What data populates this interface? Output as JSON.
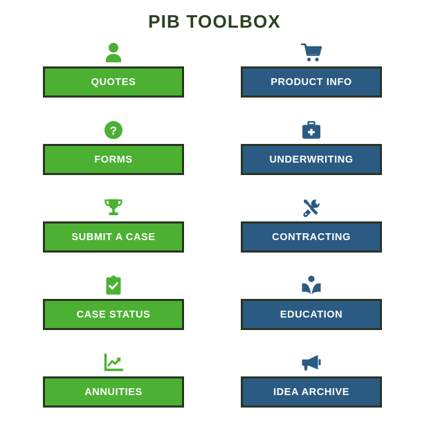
{
  "header": {
    "title": "PIB TOOLBOX",
    "title_color": "#2c4020"
  },
  "theme": {
    "green": "#4cb033",
    "blue": "#2b5b83",
    "border": "#2a3524",
    "label_color": "#ffffff",
    "background": "#ffffff"
  },
  "tiles": [
    {
      "label": "QUOTES",
      "color": "green",
      "icon": "user-icon",
      "icon_color": "#4cb033"
    },
    {
      "label": "PRODUCT INFO",
      "color": "blue",
      "icon": "shopping-cart-icon",
      "icon_color": "#2b5b83"
    },
    {
      "label": "FORMS",
      "color": "green",
      "icon": "question-circle-icon",
      "icon_color": "#4cb033"
    },
    {
      "label": "UNDERWRITING",
      "color": "blue",
      "icon": "first-aid-kit-icon",
      "icon_color": "#2b5b83"
    },
    {
      "label": "SUBMIT A CASE",
      "color": "green",
      "icon": "trophy-icon",
      "icon_color": "#4cb033"
    },
    {
      "label": "CONTRACTING",
      "color": "blue",
      "icon": "tools-icon",
      "icon_color": "#2b5b83"
    },
    {
      "label": "CASE STATUS",
      "color": "green",
      "icon": "clipboard-check-icon",
      "icon_color": "#4cb033"
    },
    {
      "label": "EDUCATION",
      "color": "blue",
      "icon": "open-book-reader-icon",
      "icon_color": "#2b5b83"
    },
    {
      "label": "ANNUITIES",
      "color": "green",
      "icon": "line-chart-icon",
      "icon_color": "#4cb033"
    },
    {
      "label": "IDEA ARCHIVE",
      "color": "blue",
      "icon": "megaphone-icon",
      "icon_color": "#2b5b83"
    }
  ]
}
